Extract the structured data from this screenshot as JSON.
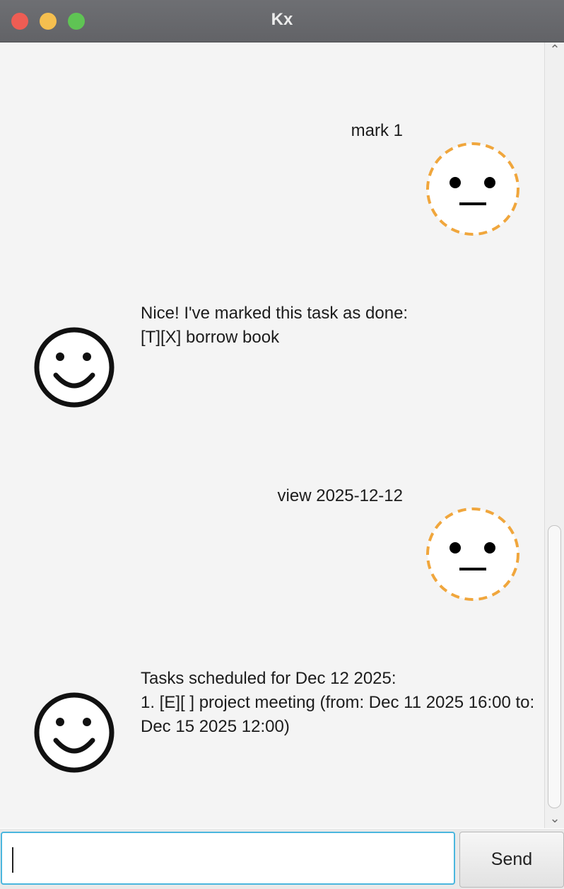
{
  "window": {
    "title": "Kx"
  },
  "messages": [
    {
      "sender": "user",
      "lines": [
        "mark 1"
      ]
    },
    {
      "sender": "bot",
      "lines": [
        "Nice! I've marked this task as done:",
        "[T][X] borrow book"
      ]
    },
    {
      "sender": "user",
      "lines": [
        "view 2025-12-12"
      ]
    },
    {
      "sender": "bot",
      "lines": [
        "Tasks scheduled for Dec 12 2025:",
        "1. [E][ ] project meeting (from: Dec 11 2025 16:00 to:",
        "Dec 15 2025 12:00)"
      ]
    }
  ],
  "input": {
    "value": "",
    "placeholder": ""
  },
  "send_button": {
    "label": "Send"
  },
  "icons": {
    "user_avatar": "neutral-face-icon",
    "bot_avatar": "smiley-face-icon"
  },
  "colors": {
    "user_avatar_ring": "#f0a63c",
    "chat_bg": "#f4f4f4",
    "input_focus": "#4ab6de"
  }
}
